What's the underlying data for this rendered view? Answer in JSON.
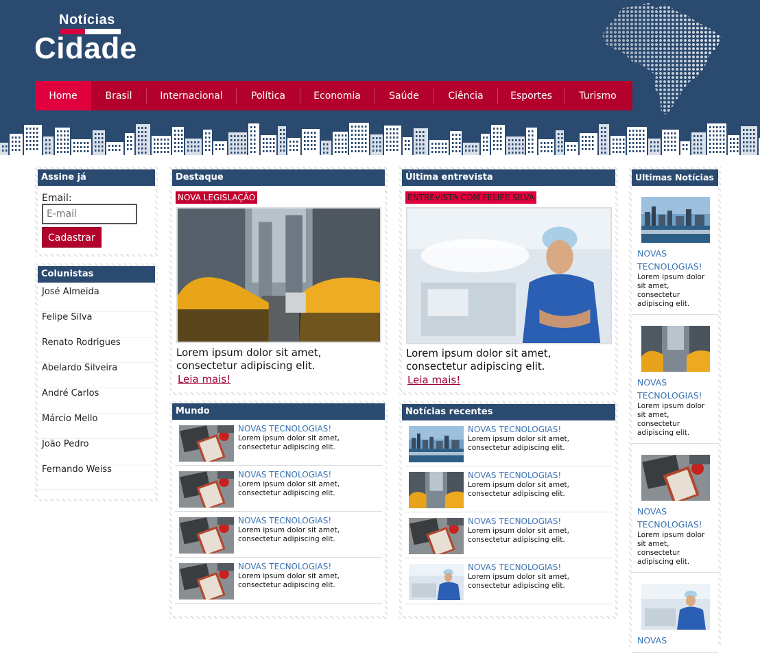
{
  "brand": {
    "top": "Notícias",
    "main": "Cidade"
  },
  "nav": [
    "Home",
    "Brasil",
    "Internacional",
    "Política",
    "Economia",
    "Saúde",
    "Ciência",
    "Esportes",
    "Turismo"
  ],
  "subscribe": {
    "title": "Assine já",
    "email_label": "Email:",
    "email_placeholder": "E-mail",
    "button": "Cadastrar"
  },
  "columnists": {
    "title": "Colunistas",
    "items": [
      "José Almeida",
      "Felipe Silva",
      "Renato Rodrigues",
      "Abelardo Silveira",
      "André Carlos",
      "Márcio Mello",
      "João Pedro",
      "Fernando Weiss"
    ]
  },
  "featured": {
    "title": "Destaque",
    "tag": "NOVA LEGISLAÇÃO",
    "text": "Lorem ipsum dolor sit amet, consectetur adipiscing elit.",
    "link": "Leia mais!"
  },
  "interview": {
    "title": "Última entrevista",
    "tag": "ENTREVISTA COM FELIPE SILVA",
    "text": "Lorem ipsum dolor sit amet, consectetur adipiscing elit.",
    "link": "Leia mais!"
  },
  "world": {
    "title": "Mundo",
    "items": [
      {
        "title": "NOVAS TECNOLOGIAS!",
        "body": "Lorem ipsum dolor sit amet, consectetur adipiscing elit.",
        "image": "notebook"
      },
      {
        "title": "NOVAS TECNOLOGIAS!",
        "body": "Lorem ipsum dolor sit amet, consectetur adipiscing elit.",
        "image": "notebook"
      },
      {
        "title": "NOVAS TECNOLOGIAS!",
        "body": "Lorem ipsum dolor sit amet, consectetur adipiscing elit.",
        "image": "notebook"
      },
      {
        "title": "NOVAS TECNOLOGIAS!",
        "body": "Lorem ipsum dolor sit amet, consectetur adipiscing elit.",
        "image": "notebook"
      }
    ]
  },
  "recent": {
    "title": "Notícias recentes",
    "items": [
      {
        "title": "NOVAS TECNOLOGIAS!",
        "body": "Lorem ipsum dolor sit amet, consectetur adipiscing elit.",
        "image": "skyline"
      },
      {
        "title": "NOVAS TECNOLOGIAS!",
        "body": "Lorem ipsum dolor sit amet, consectetur adipiscing elit.",
        "image": "taxi"
      },
      {
        "title": "NOVAS TECNOLOGIAS!",
        "body": "Lorem ipsum dolor sit amet, consectetur adipiscing elit.",
        "image": "notebook"
      },
      {
        "title": "NOVAS TECNOLOGIAS!",
        "body": "Lorem ipsum dolor sit amet, consectetur adipiscing elit.",
        "image": "doctor"
      }
    ]
  },
  "latest": {
    "title": "Ultimas Notícias",
    "items": [
      {
        "title": "NOVAS TECNOLOGIAS!",
        "body": "Lorem ipsum dolor sit amet, consectetur adipiscing elit.",
        "image": "skyline"
      },
      {
        "title": "NOVAS TECNOLOGIAS!",
        "body": "Lorem ipsum dolor sit amet, consectetur adipiscing elit.",
        "image": "taxi"
      },
      {
        "title": "NOVAS TECNOLOGIAS!",
        "body": "Lorem ipsum dolor sit amet, consectetur adipiscing elit.",
        "image": "notebook"
      },
      {
        "title": "NOVAS",
        "body": "",
        "image": "doctor"
      }
    ]
  },
  "colors": {
    "header": "#2b4a6f",
    "nav": "#b4002d",
    "accent": "#e0003d",
    "link": "#3b74b5"
  }
}
